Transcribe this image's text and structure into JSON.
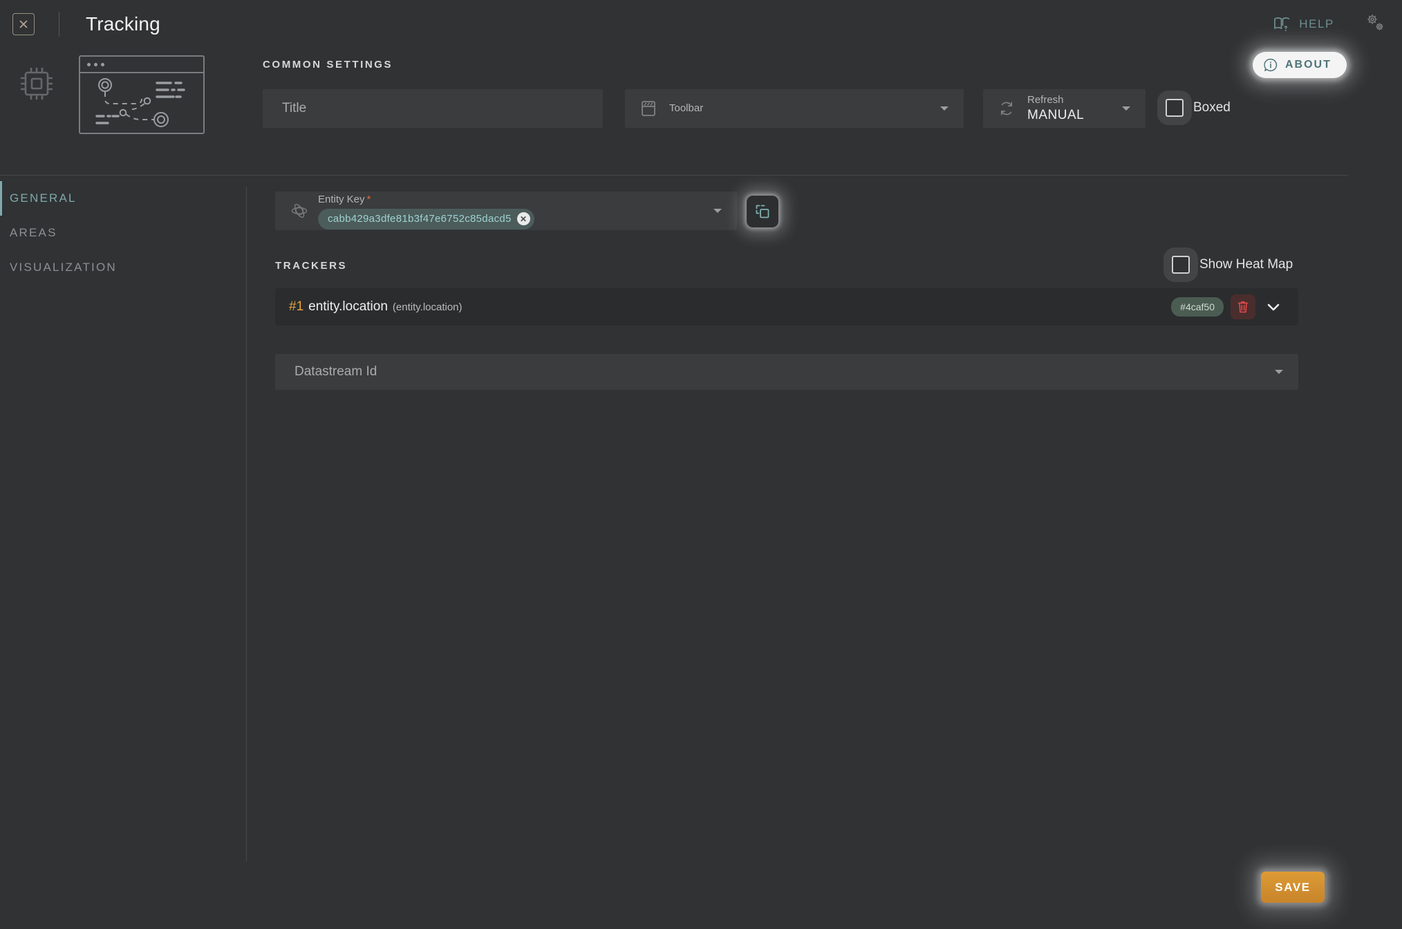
{
  "window": {
    "title": "Tracking",
    "close_icon": "close-box-icon",
    "widget_type_icon": "chip-icon",
    "preview_icon": "tracking-preview-thumbnail"
  },
  "topbar": {
    "help_label": "HELP",
    "help_icon": "book-question-icon",
    "settings_icon": "gears-icon",
    "about_label": "ABOUT",
    "about_icon": "info-circle-icon"
  },
  "common_settings": {
    "section_label": "COMMON SETTINGS",
    "title": {
      "placeholder": "Title",
      "value": ""
    },
    "toolbar": {
      "label": "Toolbar",
      "value": "",
      "icon": "toolbar-icon",
      "caret_icon": "chevron-down-icon"
    },
    "refresh": {
      "label": "Refresh",
      "value": "MANUAL",
      "icon": "refresh-icon",
      "caret_icon": "chevron-down-icon"
    },
    "boxed": {
      "label": "Boxed",
      "checked": false,
      "icon": "checkbox-unchecked-icon"
    }
  },
  "sidebar": {
    "items": [
      {
        "label": "GENERAL",
        "active": true
      },
      {
        "label": "AREAS",
        "active": false
      },
      {
        "label": "VISUALIZATION",
        "active": false
      }
    ]
  },
  "main": {
    "entity_key": {
      "label": "Entity Key",
      "required_mark": "*",
      "chip_value": "cabb429a3dfe81b3f47e6752c85dacd5",
      "chip_remove_icon": "close-circle-icon",
      "field_icon": "target-entity-icon",
      "caret_icon": "chevron-down-icon"
    },
    "copy_button": {
      "icon": "copy-duplicate-icon"
    },
    "trackers": {
      "section_label": "TRACKERS",
      "show_heat_map": {
        "label": "Show Heat Map",
        "checked": false,
        "icon": "checkbox-unchecked-icon"
      },
      "rows": [
        {
          "index": "#1",
          "name": "entity.location",
          "source": "(entity.location)",
          "color": "#4caf50",
          "delete_icon": "trash-icon",
          "expand_icon": "chevron-down-icon"
        }
      ]
    },
    "datastream": {
      "placeholder": "Datastream Id",
      "value": "",
      "caret_icon": "chevron-down-icon"
    }
  },
  "footer": {
    "save_label": "SAVE"
  },
  "theme": {
    "page_bg": "#303234",
    "field_bg": "#3a3c3e",
    "row_bg": "#2a2c2e",
    "accent_teal": "#7fa9ab",
    "accent_orange": "#e8a33d",
    "save_orange": "#d0892c",
    "required_red": "#e06a3a",
    "tracker_color": "#4caf50"
  }
}
